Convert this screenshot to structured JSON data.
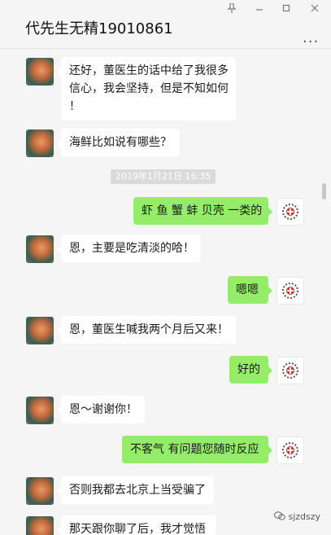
{
  "window": {
    "title": "代先生无精19010861",
    "pin_icon": "pin-icon",
    "minimize_icon": "minimize-icon",
    "maximize_icon": "maximize-icon",
    "close_icon": "close-icon",
    "more_label": "..."
  },
  "messages": [
    {
      "side": "left",
      "lines": [
        "还好，董医生的话中给了我很多",
        "信心，我会坚持，但是不知如何",
        "！"
      ]
    },
    {
      "side": "left",
      "lines": [
        "海鲜比如说有哪些？"
      ]
    },
    {
      "side": "time",
      "lines": [
        "2019年1月21日 16:35"
      ]
    },
    {
      "side": "right",
      "lines": [
        "虾 鱼 蟹 蚌 贝壳 一类的"
      ]
    },
    {
      "side": "left",
      "lines": [
        "恩，主要是吃清淡的哈！"
      ]
    },
    {
      "side": "right",
      "lines": [
        "嗯嗯"
      ]
    },
    {
      "side": "left",
      "lines": [
        "恩，董医生喊我两个月后又来！"
      ]
    },
    {
      "side": "right",
      "lines": [
        "好的"
      ]
    },
    {
      "side": "left",
      "lines": [
        "恩～谢谢你！"
      ]
    },
    {
      "side": "right",
      "lines": [
        "不客气 有问题您随时反应"
      ]
    },
    {
      "side": "left",
      "lines": [
        "否则我都去北京上当受骗了"
      ]
    },
    {
      "side": "left",
      "lines": [
        "那天跟你聊了后，我才觉悟"
      ]
    }
  ],
  "watermark": "sjzdszy",
  "colors": {
    "self_bubble": "#95ec69",
    "peer_bubble": "#ffffff",
    "background": "#f5f5f5"
  }
}
